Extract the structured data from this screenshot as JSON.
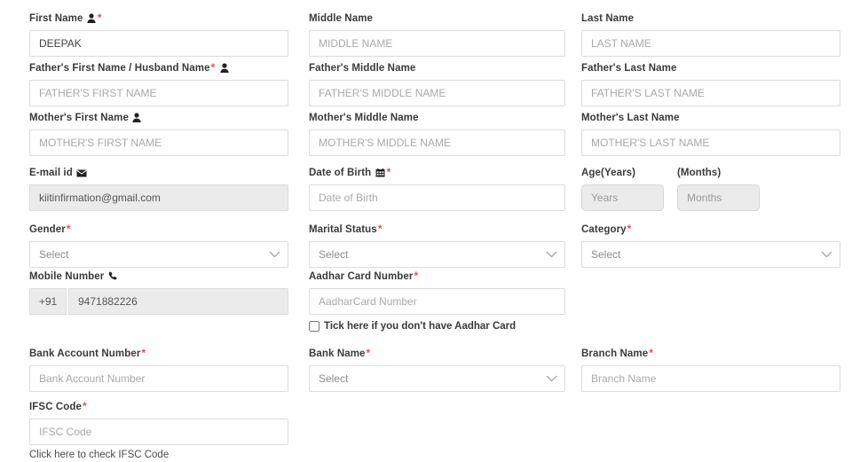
{
  "theme": {
    "required_asterisk_color": "#d9534f",
    "label_color": "#3a3a3a",
    "input_border": "#dcdcdc",
    "disabled_bg": "#ebebeb",
    "placeholder_color": "#a9a9a9"
  },
  "fields": {
    "first_name": {
      "label": "First Name",
      "icon": "person-icon",
      "required": true,
      "value": "DEEPAK",
      "placeholder": ""
    },
    "middle_name": {
      "label": "Middle Name",
      "required": false,
      "value": "",
      "placeholder": "MIDDLE NAME"
    },
    "last_name": {
      "label": "Last Name",
      "required": false,
      "value": "",
      "placeholder": "LAST NAME"
    },
    "fathers_first_name": {
      "label": "Father's First Name / Husband Name",
      "icon": "person-icon",
      "required": true,
      "value": "",
      "placeholder": "FATHER'S FIRST NAME"
    },
    "fathers_middle_name": {
      "label": "Father's Middle Name",
      "required": false,
      "value": "",
      "placeholder": "FATHER'S MIDDLE NAME"
    },
    "fathers_last_name": {
      "label": "Father's Last Name",
      "required": false,
      "value": "",
      "placeholder": "FATHER'S LAST NAME"
    },
    "mothers_first_name": {
      "label": "Mother's First Name",
      "icon": "person-icon",
      "required": false,
      "value": "",
      "placeholder": "MOTHER'S FIRST NAME"
    },
    "mothers_middle_name": {
      "label": "Mother's Middle Name",
      "required": false,
      "value": "",
      "placeholder": "MOTHER'S MIDDLE NAME"
    },
    "mothers_last_name": {
      "label": "Mother's Last Name",
      "required": false,
      "value": "",
      "placeholder": "MOTHER'S LAST NAME"
    },
    "email": {
      "label": "E-mail id",
      "icon": "envelope-icon",
      "required": false,
      "value": "kiitinfirmation@gmail.com",
      "placeholder": "",
      "disabled": true
    },
    "date_of_birth": {
      "label": "Date of Birth",
      "icon": "calendar-icon",
      "required": true,
      "value": "",
      "placeholder": "Date of Birth"
    },
    "age_years": {
      "label": "Age(Years)",
      "required": false,
      "value": "",
      "placeholder": "Years",
      "disabled": true
    },
    "age_months": {
      "label": "(Months)",
      "required": false,
      "value": "",
      "placeholder": "Months",
      "disabled": true
    },
    "gender": {
      "label": "Gender",
      "required": true,
      "selected": "Select",
      "options": [
        "Select"
      ]
    },
    "marital_status": {
      "label": "Marital Status",
      "required": true,
      "selected": "Select",
      "options": [
        "Select"
      ]
    },
    "category": {
      "label": "Category",
      "required": true,
      "selected": "Select",
      "options": [
        "Select"
      ]
    },
    "mobile_number": {
      "label": "Mobile Number",
      "icon": "phone-icon",
      "required": false,
      "country_code": "+91",
      "value": "9471882226",
      "placeholder": "",
      "disabled": true
    },
    "aadhar_card_number": {
      "label": "Aadhar Card Number",
      "required": true,
      "value": "",
      "placeholder": "AadharCard Number"
    },
    "no_aadhar_checkbox": {
      "label": "Tick here if you don't have Aadhar Card",
      "checked": false
    },
    "bank_account_number": {
      "label": "Bank Account Number",
      "required": true,
      "value": "",
      "placeholder": "Bank Account Number"
    },
    "bank_name": {
      "label": "Bank Name",
      "required": true,
      "selected": "Select",
      "options": [
        "Select"
      ]
    },
    "branch_name": {
      "label": "Branch Name",
      "required": true,
      "value": "",
      "placeholder": "Branch Name"
    },
    "ifsc_code": {
      "label": "IFSC Code",
      "required": true,
      "value": "",
      "placeholder": "IFSC Code"
    },
    "ifsc_helper_link": {
      "label": "Click here to check IFSC Code"
    }
  }
}
